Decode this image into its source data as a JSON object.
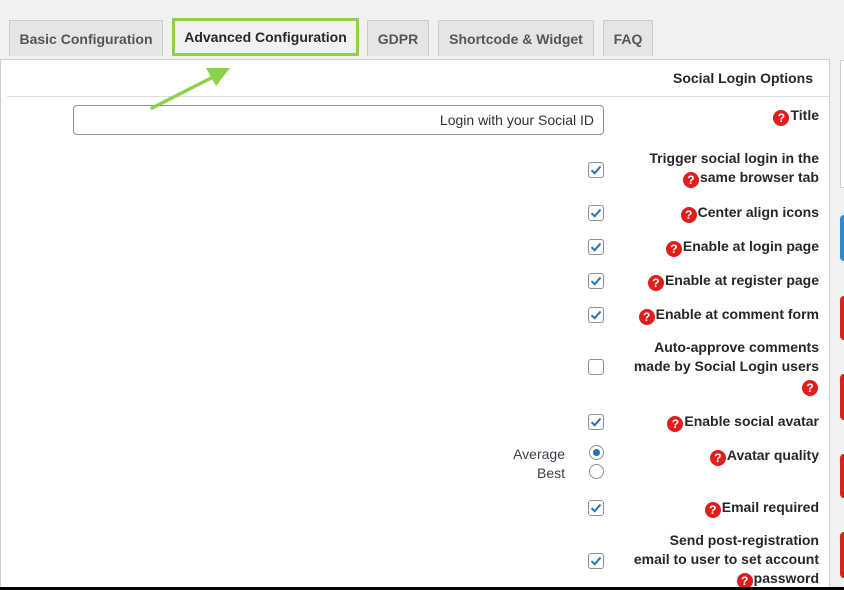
{
  "tabs": [
    {
      "label": "Basic Configuration",
      "active": false
    },
    {
      "label": "Advanced Configuration",
      "active": true
    },
    {
      "label": "GDPR",
      "active": false
    },
    {
      "label": "Shortcode & Widget",
      "active": false
    },
    {
      "label": "FAQ",
      "active": false
    }
  ],
  "section_title": "Social Login Options",
  "title_field": {
    "label": "Title",
    "value": "Login with your Social ID"
  },
  "options": {
    "same_tab": {
      "line1": "Trigger social login in the",
      "line2": "same browser tab",
      "checked": true
    },
    "center_icons": {
      "label": "Center align icons",
      "checked": true
    },
    "login_page": {
      "label": "Enable at login page",
      "checked": true
    },
    "register_page": {
      "label": "Enable at register page",
      "checked": true
    },
    "comment_form": {
      "label": "Enable at comment form",
      "checked": true
    },
    "auto_approve": {
      "line1": "Auto-approve comments",
      "line2": "made by Social Login users",
      "checked": false
    },
    "social_avatar": {
      "label": "Enable social avatar",
      "checked": true
    },
    "avatar_quality": {
      "label": "Avatar quality",
      "options": [
        "Average",
        "Best"
      ],
      "selected": "Average"
    },
    "email_required": {
      "label": "Email required",
      "checked": true
    },
    "post_registration": {
      "line1": "Send post-registration",
      "line2": "email to user to set account",
      "line3": "password",
      "checked": true
    }
  },
  "help_icon": "question-circle-icon",
  "colors": {
    "accent_green": "#8bd14a",
    "help_red": "#e31c1c",
    "check_blue": "#2271b1"
  }
}
